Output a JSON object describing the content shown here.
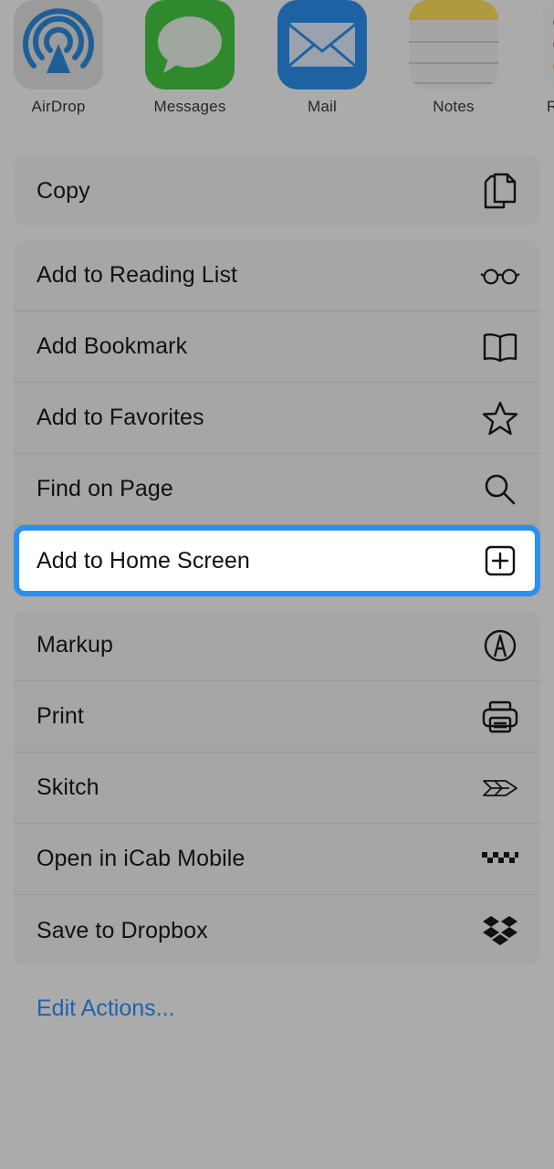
{
  "share_apps": [
    {
      "name": "AirDrop",
      "icon": "airdrop-icon"
    },
    {
      "name": "Messages",
      "icon": "messages-icon"
    },
    {
      "name": "Mail",
      "icon": "mail-icon"
    },
    {
      "name": "Notes",
      "icon": "notes-icon"
    },
    {
      "name": "R",
      "icon": "reminders-icon"
    }
  ],
  "copy_group": [
    {
      "label": "Copy",
      "icon": "copy-icon"
    }
  ],
  "actions_group": [
    {
      "label": "Add to Reading List",
      "icon": "glasses-icon"
    },
    {
      "label": "Add Bookmark",
      "icon": "book-icon"
    },
    {
      "label": "Add to Favorites",
      "icon": "star-icon"
    },
    {
      "label": "Find on Page",
      "icon": "search-icon"
    },
    {
      "label": "Add to Home Screen",
      "icon": "plus-square-icon",
      "highlighted": true
    }
  ],
  "extensions_group": [
    {
      "label": "Markup",
      "icon": "markup-pen-icon"
    },
    {
      "label": "Print",
      "icon": "printer-icon"
    },
    {
      "label": "Skitch",
      "icon": "skitch-arrow-icon"
    },
    {
      "label": "Open in iCab Mobile",
      "icon": "icab-checker-icon"
    },
    {
      "label": "Save to Dropbox",
      "icon": "dropbox-icon"
    }
  ],
  "edit_actions_label": "Edit Actions...",
  "colors": {
    "dim_background": "#ababab",
    "highlight_border": "#2a8ff0",
    "link": "#1d63ad"
  }
}
